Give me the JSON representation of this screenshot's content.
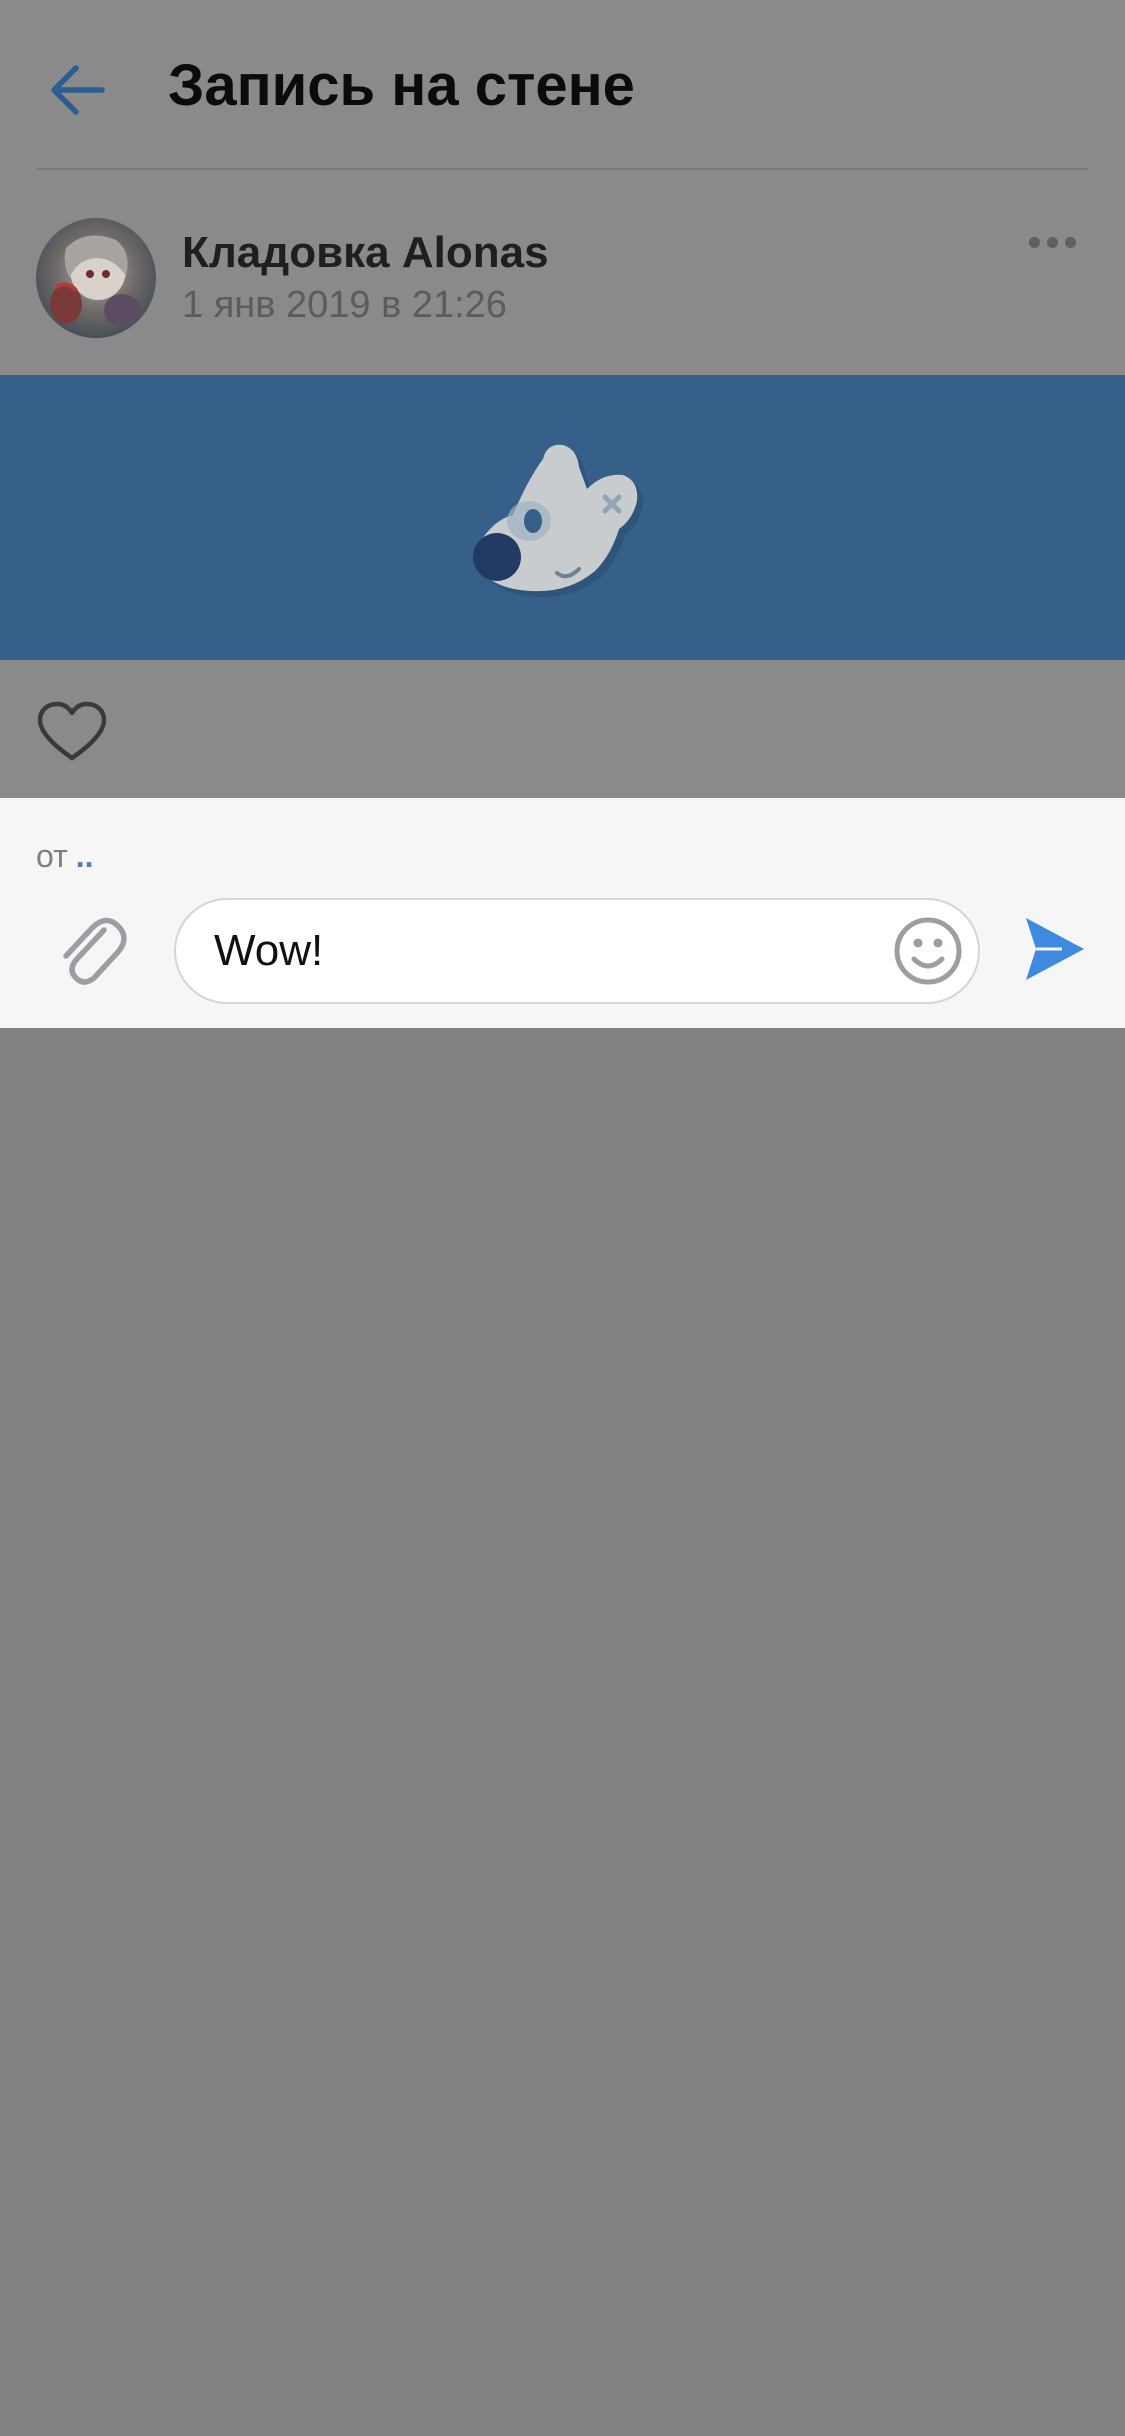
{
  "header": {
    "title": "Запись на стене",
    "back_icon": "arrow-left-icon"
  },
  "post": {
    "author": "Кладовка Alonas",
    "date": "1 янв 2019 в 21:26",
    "more_icon": "more-horizontal-icon",
    "image": "vk-dog-mascot-image",
    "like_icon": "heart-outline-icon"
  },
  "composer": {
    "from_label": "от",
    "from_name": "..",
    "input_value": "Wow!",
    "attach_icon": "paperclip-icon",
    "emoji_icon": "smile-icon",
    "send_icon": "send-icon"
  },
  "colors": {
    "accent": "#3f8ae0",
    "image_bg": "#36608a",
    "overlay": "#818284"
  }
}
